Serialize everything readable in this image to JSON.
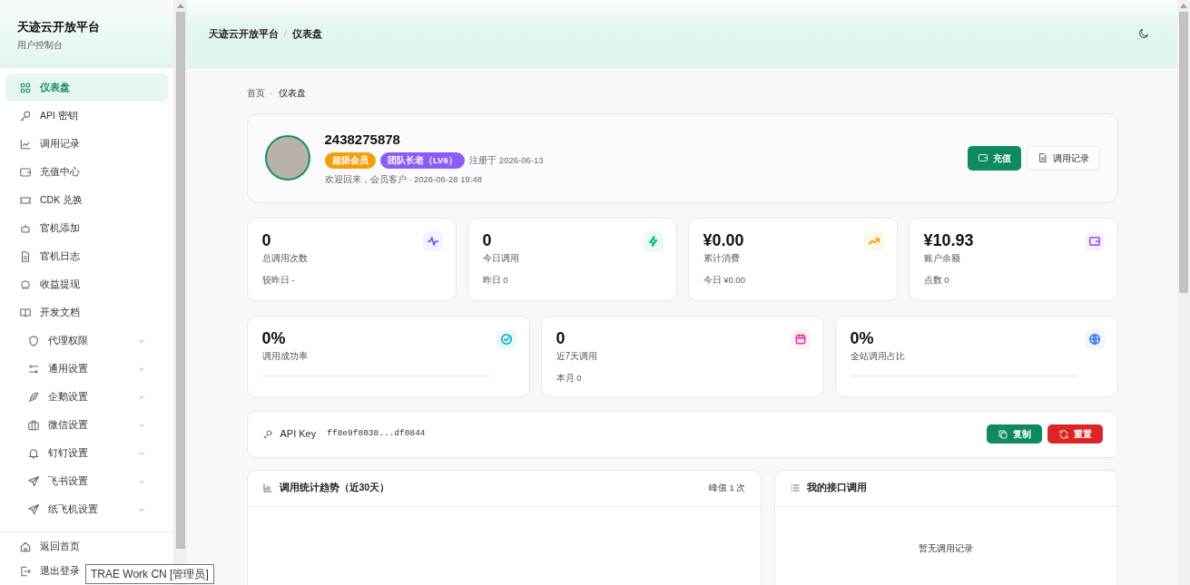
{
  "sidebar": {
    "title": "天迹云开放平台",
    "subtitle": "用户控制台",
    "items": [
      {
        "label": "仪表盘",
        "kind": "link",
        "selected": true
      },
      {
        "label": "API 密钥",
        "kind": "link",
        "selected": false
      },
      {
        "label": "调用记录",
        "kind": "link",
        "selected": false
      },
      {
        "label": "充值中心",
        "kind": "link",
        "selected": false
      },
      {
        "label": "CDK 兑换",
        "kind": "link",
        "selected": false
      },
      {
        "label": "官机添加",
        "kind": "link",
        "selected": false
      },
      {
        "label": "官机日志",
        "kind": "link",
        "selected": false
      },
      {
        "label": "收益提现",
        "kind": "link",
        "selected": false
      },
      {
        "label": "开发文档",
        "kind": "link",
        "selected": false
      },
      {
        "label": "代理权限",
        "kind": "group",
        "selected": false,
        "expanded": false
      },
      {
        "label": "通用设置",
        "kind": "group",
        "selected": false,
        "expanded": false
      },
      {
        "label": "企鹅设置",
        "kind": "group",
        "selected": false,
        "expanded": false
      },
      {
        "label": "微信设置",
        "kind": "group",
        "selected": false,
        "expanded": false
      },
      {
        "label": "钉钉设置",
        "kind": "group",
        "selected": false,
        "expanded": false
      },
      {
        "label": "飞书设置",
        "kind": "group",
        "selected": false,
        "expanded": false
      },
      {
        "label": "纸飞机设置",
        "kind": "group",
        "selected": false,
        "expanded": false
      }
    ],
    "footer_items": [
      {
        "label": "返回首页"
      },
      {
        "label": "退出登录"
      }
    ]
  },
  "header": {
    "breadcrumb": [
      "天迹云开放平台",
      "仪表盘"
    ],
    "separator": "/"
  },
  "breadcrumb": {
    "items": [
      "首页",
      "仪表盘"
    ],
    "separator": "›"
  },
  "profile": {
    "name": "2438275878",
    "badges": [
      {
        "label": "超级会员",
        "color": "#f59e0b"
      },
      {
        "label": "团队长老（LV6）",
        "color": "#8b5cf6"
      }
    ],
    "registered": "注册于 2026-06-13",
    "welcome": "欢迎回来，会员客户 · 2026-06-28 19:48",
    "buttons": [
      {
        "label": "充值",
        "kind": "primary"
      },
      {
        "label": "调用记录",
        "kind": "outline"
      }
    ]
  },
  "stats": [
    {
      "value": "0",
      "label": "总调用次数",
      "sub": "较昨日 -",
      "color": "#6366f1"
    },
    {
      "value": "0",
      "label": "今日调用",
      "sub": "昨日 0",
      "color": "#10b981"
    },
    {
      "value": "¥0.00",
      "label": "累计消费",
      "sub": "今日 ¥0.00",
      "color": "#f59e0b"
    },
    {
      "value": "¥10.93",
      "label": "账户余额",
      "sub": "点数 0",
      "color": "#a855f7"
    }
  ],
  "stats2": [
    {
      "value": "0%",
      "label": "调用成功率",
      "color": "#06b6d4",
      "level": 0
    },
    {
      "value": "0",
      "label": "近7天调用",
      "sub": "本月 0",
      "color": "#ec4899"
    },
    {
      "value": "0%",
      "label": "全站调用占比",
      "color": "#3b82f6",
      "level": 0
    }
  ],
  "api_key": {
    "label": "API Key",
    "value": "ff8e9f8038...df0844",
    "buttons": [
      {
        "label": "复制",
        "kind": "success"
      },
      {
        "label": "重置",
        "kind": "danger"
      }
    ]
  },
  "panels": [
    {
      "title": "调用统计趋势（近30天）",
      "note": "峰值 1 次"
    },
    {
      "title": "我的接口调用",
      "empty": "暂无调用记录"
    }
  ],
  "tooltip": "TRAE Work CN [管理员]"
}
